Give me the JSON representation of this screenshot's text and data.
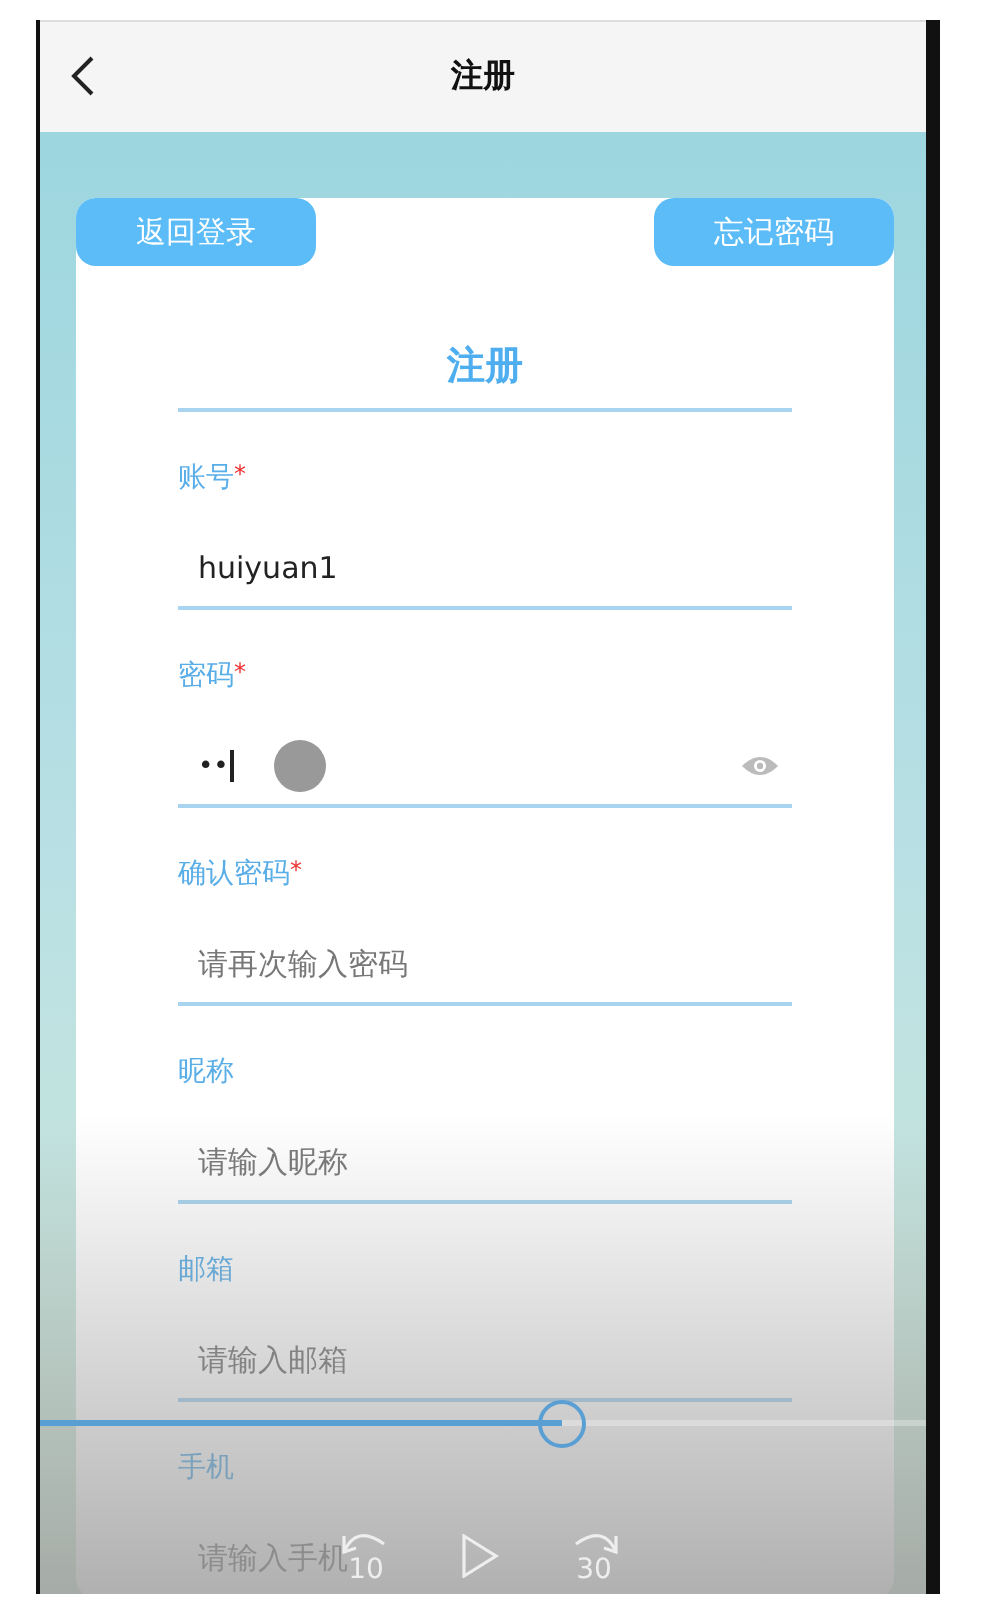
{
  "header": {
    "title": "注册"
  },
  "card": {
    "left_button": "返回登录",
    "right_button": "忘记密码",
    "title": "注册",
    "fields": [
      {
        "kind": "text",
        "label": "账号",
        "required_mark": "*",
        "value": "huiyuan1"
      },
      {
        "kind": "password",
        "label": "密码",
        "required_mark": "*",
        "value": "••",
        "focused": true
      },
      {
        "kind": "text",
        "label": "确认密码",
        "required_mark": "*",
        "placeholder": "请再次输入密码"
      },
      {
        "kind": "text",
        "label": "昵称",
        "placeholder": "请输入昵称"
      },
      {
        "kind": "text",
        "label": "邮箱",
        "placeholder": "请输入邮箱"
      },
      {
        "kind": "text",
        "label": "手机",
        "placeholder": "请输入手机"
      }
    ]
  },
  "player": {
    "level": 0.59,
    "rewind_label": "10",
    "forward_label": "30"
  }
}
